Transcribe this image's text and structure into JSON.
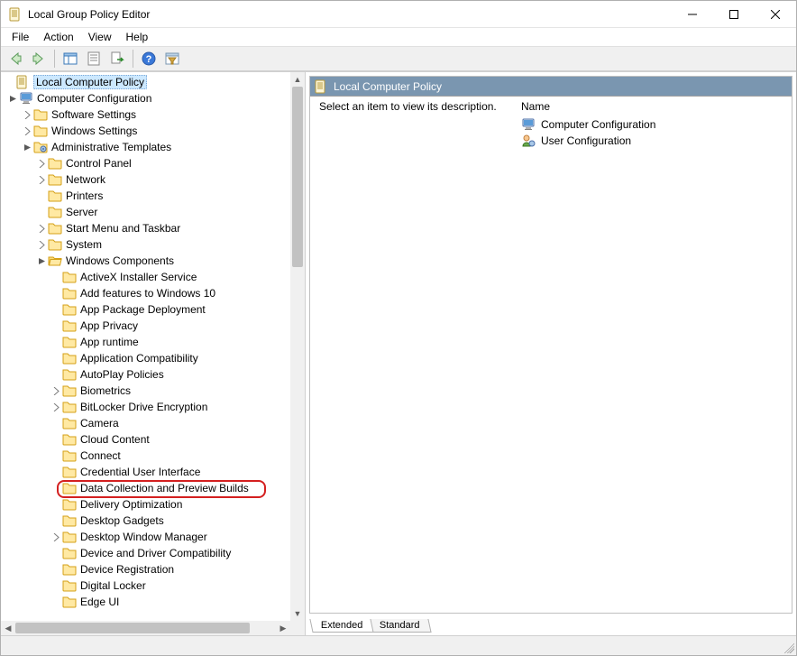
{
  "window": {
    "title": "Local Group Policy Editor"
  },
  "menu": {
    "file": "File",
    "action": "Action",
    "view": "View",
    "help": "Help"
  },
  "tree": {
    "root": "Local Computer Policy",
    "computer_cfg": "Computer Configuration",
    "software_settings": "Software Settings",
    "windows_settings": "Windows Settings",
    "admin_templates": "Administrative Templates",
    "control_panel": "Control Panel",
    "network": "Network",
    "printers": "Printers",
    "server": "Server",
    "start_menu": "Start Menu and Taskbar",
    "system": "System",
    "windows_components": "Windows Components",
    "wc": {
      "activex": "ActiveX Installer Service",
      "add_features": "Add features to Windows 10",
      "app_pkg": "App Package Deployment",
      "app_privacy": "App Privacy",
      "app_runtime": "App runtime",
      "app_compat": "Application Compatibility",
      "autoplay": "AutoPlay Policies",
      "biometrics": "Biometrics",
      "bitlocker": "BitLocker Drive Encryption",
      "camera": "Camera",
      "cloud_content": "Cloud Content",
      "connect": "Connect",
      "cred_ui": "Credential User Interface",
      "data_collection": "Data Collection and Preview Builds",
      "delivery_opt": "Delivery Optimization",
      "desktop_gadgets": "Desktop Gadgets",
      "dwm": "Desktop Window Manager",
      "device_driver": "Device and Driver Compatibility",
      "device_reg": "Device Registration",
      "digital_locker": "Digital Locker",
      "edge_ui": "Edge UI"
    }
  },
  "right": {
    "header": "Local Computer Policy",
    "description_prompt": "Select an item to view its description.",
    "name_header": "Name",
    "items": {
      "computer_cfg": "Computer Configuration",
      "user_cfg": "User Configuration"
    }
  },
  "tabs": {
    "extended": "Extended",
    "standard": "Standard"
  }
}
